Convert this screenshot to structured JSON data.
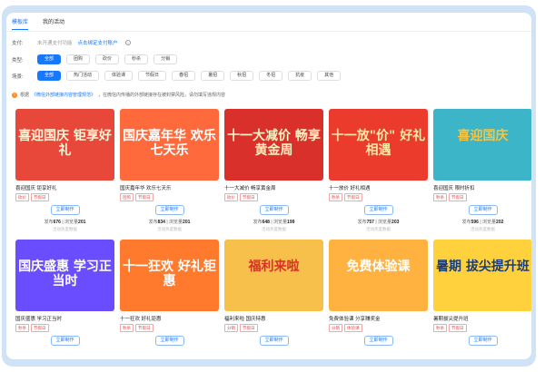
{
  "tabs": [
    {
      "label": "模板库"
    },
    {
      "label": "我的活动"
    }
  ],
  "pay": {
    "label": "支付:",
    "status": "未开通支付功能",
    "link": "点击绑定支付账户"
  },
  "type_filter": {
    "label": "类型:",
    "options": [
      "全部",
      "团购",
      "砍价",
      "秒杀",
      "分销"
    ]
  },
  "scene_filter": {
    "label": "场景:",
    "options": [
      "全部",
      "热门活动",
      "体验课",
      "节假日",
      "春招",
      "暑招",
      "秋招",
      "冬招",
      "抗疫",
      "其他"
    ]
  },
  "notice": {
    "pre": "根据",
    "link": "《微信外部链接内容管理规范》",
    "post": "，在微信内传播的外部链接存在被封禁风险，请勿填写违规内容"
  },
  "cards": [
    {
      "poster": "喜迎国庆 钜享好礼",
      "title": "喜迎国庆 钜享好礼",
      "tags": [
        "砍价",
        "节假日"
      ],
      "button": "立即制作",
      "publish": "676",
      "views": "201",
      "note": "活动热度数据",
      "bg": "#e8483a",
      "fg": "#fff6d8"
    },
    {
      "poster": "国庆嘉年华 欢乐七天乐",
      "title": "国庆嘉年华 欢乐七天乐",
      "tags": [
        "团购",
        "节假日"
      ],
      "button": "立即制作",
      "publish": "834",
      "views": "201",
      "note": "活动热度数据",
      "bg": "#ff6a3d",
      "fg": "#ffffff"
    },
    {
      "poster": "十一大减价 畅享黄金周",
      "title": "十一大减价 畅享黄金周",
      "tags": [
        "砍价",
        "节假日"
      ],
      "button": "立即制作",
      "publish": "648",
      "views": "199",
      "note": "活动热度数据",
      "bg": "#d9302b",
      "fg": "#fff2c4"
    },
    {
      "poster": "十一放\"价\" 好礼相遇",
      "title": "十一放价 好礼相遇",
      "tags": [
        "秒杀",
        "节假日"
      ],
      "button": "立即制作",
      "publish": "757",
      "views": "203",
      "note": "活动热度数据",
      "bg": "#ea3b2d",
      "fg": "#ffe9a8"
    },
    {
      "poster": "喜迎国庆",
      "title": "喜迎国庆 限时折扣",
      "tags": [
        "秒杀",
        "节假日"
      ],
      "button": "立即制作",
      "publish": "596",
      "views": "202",
      "note": "活动热度数据",
      "bg": "#3db5c8",
      "fg": "#f5c542"
    },
    {
      "poster": "国庆盛惠 学习正当时",
      "title": "国庆盛惠 学习正当时",
      "tags": [
        "秒杀",
        "节假日"
      ],
      "button": "立即制作",
      "publish": "",
      "views": "",
      "note": "",
      "bg": "#6a4dff",
      "fg": "#ffffff"
    },
    {
      "poster": "十一狂欢 好礼钜惠",
      "title": "十一狂欢 好礼钜惠",
      "tags": [
        "秒杀",
        "节假日"
      ],
      "button": "立即制作",
      "publish": "",
      "views": "",
      "note": "",
      "bg": "#ff7a2d",
      "fg": "#ffffff"
    },
    {
      "poster": "福利来啦",
      "title": "福利来啦 国庆特惠",
      "tags": [
        "分销",
        "节假日"
      ],
      "button": "立即制作",
      "publish": "",
      "views": "",
      "note": "",
      "bg": "#f6c04a",
      "fg": "#d9302b"
    },
    {
      "poster": "免费体验课",
      "title": "免费体验课 分享赚奖金",
      "tags": [
        "分销",
        "体验课"
      ],
      "button": "立即制作",
      "publish": "",
      "views": "",
      "note": "",
      "bg": "#ffb23f",
      "fg": "#ffffff"
    },
    {
      "poster": "暑期 拔尖提升班",
      "title": "暑期拔尖提升班",
      "tags": [
        "秒杀",
        "节假日"
      ],
      "button": "立即制作",
      "publish": "",
      "views": "",
      "note": "",
      "bg": "#ffd23d",
      "fg": "#1a3d7a"
    }
  ],
  "stats_labels": {
    "publish": "发布",
    "views": "浏览量"
  }
}
